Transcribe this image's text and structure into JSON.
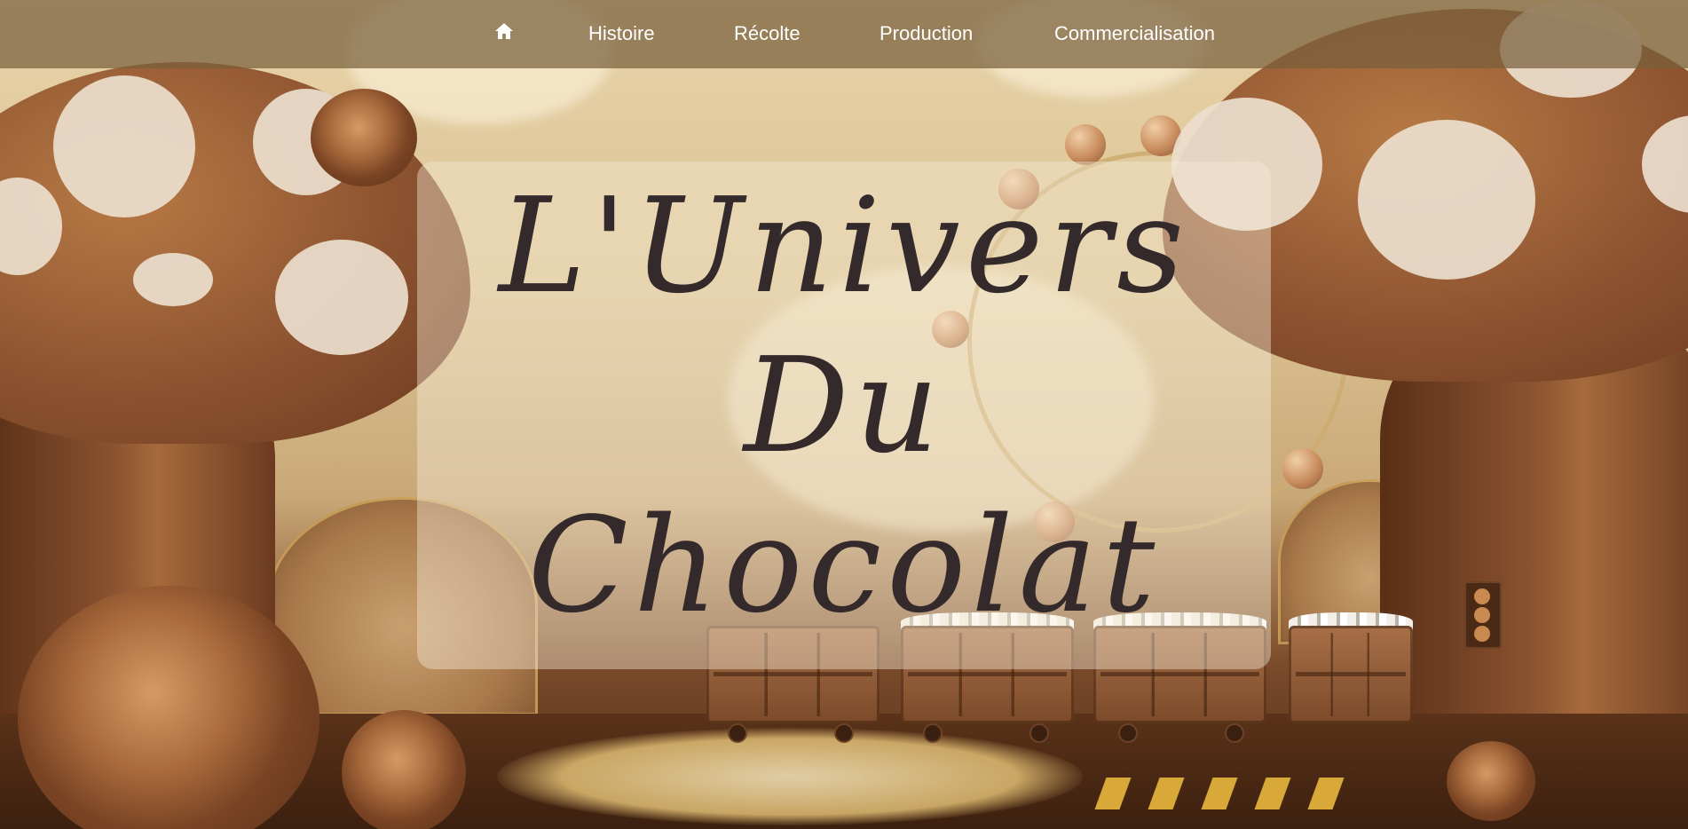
{
  "nav": {
    "home_icon": "home-icon",
    "items": [
      {
        "label": "Histoire"
      },
      {
        "label": "Récolte"
      },
      {
        "label": "Production"
      },
      {
        "label": "Commercialisation"
      }
    ]
  },
  "hero": {
    "title_line_1": "L'Univers",
    "title_line_2": "Du",
    "title_line_3": "Chocolat"
  },
  "colors": {
    "nav_bg": "#785f3c",
    "title_text": "#352a2b",
    "nav_text": "#ffffff"
  }
}
